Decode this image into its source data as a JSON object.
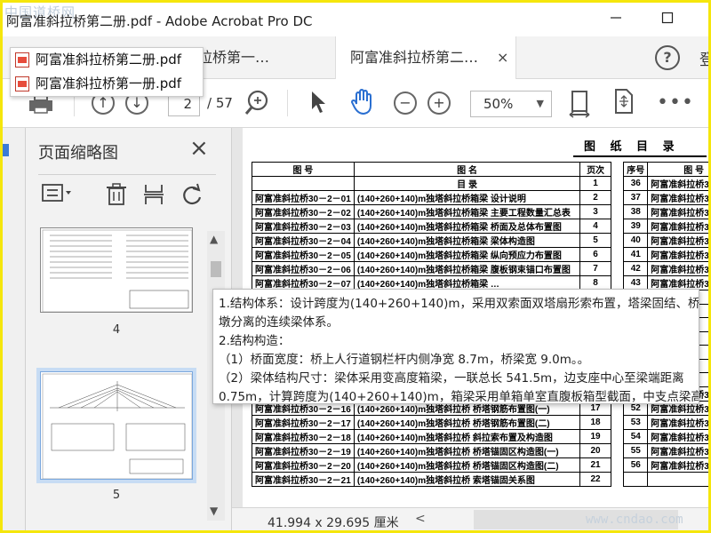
{
  "window": {
    "title": "阿富准斜拉桥第二册.pdf - Adobe Acrobat Pro DC",
    "watermark_logo": "中国道桥网",
    "minimize_icon": "minimize-icon",
    "maximize_icon": "maximize-icon"
  },
  "tabs": [
    {
      "label": "拉桥第一…",
      "active": false
    },
    {
      "label": "阿富准斜拉桥第二…",
      "active": true,
      "close": "×"
    }
  ],
  "help_label": "?",
  "signin_label": "登",
  "recent_files": [
    {
      "name": "阿富准斜拉桥第二册.pdf"
    },
    {
      "name": "阿富准斜拉桥第一册.pdf"
    }
  ],
  "toolbar": {
    "page_current": "2",
    "page_total": "/ 57",
    "zoom": "50%",
    "zoom_arrow": "▼"
  },
  "thumb_panel": {
    "title": "页面缩略图",
    "close": "×",
    "thumbnails": [
      {
        "number": "4",
        "selected": false
      },
      {
        "number": "5",
        "selected": true
      }
    ]
  },
  "document": {
    "heading": "图 纸 目 录",
    "columns": [
      "图    号",
      "图          名",
      "页次",
      "序号",
      "图    号"
    ],
    "rows": [
      {
        "code": "",
        "name": "目    录",
        "page": "1",
        "no": "36",
        "code2": "阿富准斜拉桥30－2－"
      },
      {
        "code": "阿富准斜拉桥30－2－01",
        "name": "(140+260+140)m独塔斜拉桥箱梁  设计说明",
        "page": "2",
        "no": "37",
        "code2": "阿富准斜拉桥30－2－"
      },
      {
        "code": "阿富准斜拉桥30－2－02",
        "name": "(140+260+140)m独塔斜拉桥箱梁  主要工程数量汇总表",
        "page": "3",
        "no": "38",
        "code2": "阿富准斜拉桥30－2－"
      },
      {
        "code": "阿富准斜拉桥30－2－03",
        "name": "(140+260+140)m独塔斜拉桥箱梁  桥面及总体布置图",
        "page": "4",
        "no": "39",
        "code2": "阿富准斜拉桥30－2－"
      },
      {
        "code": "阿富准斜拉桥30－2－04",
        "name": "(140+260+140)m独塔斜拉桥箱梁  梁体构造图",
        "page": "5",
        "no": "40",
        "code2": "阿富准斜拉桥30－2－"
      },
      {
        "code": "阿富准斜拉桥30－2－05",
        "name": "(140+260+140)m独塔斜拉桥箱梁  纵向预应力布置图",
        "page": "6",
        "no": "41",
        "code2": "阿富准斜拉桥30－2－"
      },
      {
        "code": "阿富准斜拉桥30－2－06",
        "name": "(140+260+140)m独塔斜拉桥箱梁  腹板钢束锚口布置图",
        "page": "7",
        "no": "42",
        "code2": "阿富准斜拉桥30－2－"
      },
      {
        "code": "阿富准斜拉桥30－2－07",
        "name": "(140+260+140)m独塔斜拉桥箱梁  …",
        "page": "8",
        "no": "43",
        "code2": "阿富准斜拉桥30－2－"
      },
      {
        "code": "",
        "name": "",
        "page": "",
        "no": "",
        "code2": ""
      },
      {
        "code": "",
        "name": "",
        "page": "",
        "no": "",
        "code2": ""
      },
      {
        "code": "",
        "name": "",
        "page": "",
        "no": "",
        "code2": ""
      },
      {
        "code": "",
        "name": "",
        "page": "",
        "no": "",
        "code2": ""
      },
      {
        "code": "",
        "name": "",
        "page": "",
        "no": "",
        "code2": ""
      },
      {
        "code": "",
        "name": "",
        "page": "",
        "no": "",
        "code2": ""
      },
      {
        "code": "",
        "name": "",
        "page": "",
        "no": "",
        "code2": ""
      },
      {
        "code": "阿富准斜拉桥30－2－15",
        "name": "(140+260+140)m独塔斜拉桥  桥塔构造图",
        "page": "16",
        "no": "51",
        "code2": "阿富准斜拉桥30－2－"
      },
      {
        "code": "阿富准斜拉桥30－2－16",
        "name": "(140+260+140)m独塔斜拉桥  桥塔钢筋布置图(一)",
        "page": "17",
        "no": "52",
        "code2": "阿富准斜拉桥30－2－"
      },
      {
        "code": "阿富准斜拉桥30－2－17",
        "name": "(140+260+140)m独塔斜拉桥  桥塔钢筋布置图(二)",
        "page": "18",
        "no": "53",
        "code2": "阿富准斜拉桥30－2－"
      },
      {
        "code": "阿富准斜拉桥30－2－18",
        "name": "(140+260+140)m独塔斜拉桥  斜拉索布置及构造图",
        "page": "19",
        "no": "54",
        "code2": "阿富准斜拉桥30－2－"
      },
      {
        "code": "阿富准斜拉桥30－2－19",
        "name": "(140+260+140)m独塔斜拉桥  桥塔锚固区构造图(一)",
        "page": "20",
        "no": "55",
        "code2": "阿富准斜拉桥30－2－"
      },
      {
        "code": "阿富准斜拉桥30－2－20",
        "name": "(140+260+140)m独塔斜拉桥  桥塔锚固区构造图(二)",
        "page": "21",
        "no": "56",
        "code2": "阿富准斜拉桥30－2－"
      },
      {
        "code": "阿富准斜拉桥30－2－21",
        "name": "(140+260+140)m独塔斜拉桥  索塔锚固关系图",
        "page": "22",
        "no": "",
        "code2": ""
      }
    ]
  },
  "popup": {
    "lines": [
      "1.结构体系：设计跨度为(140+260+140)m，采用双索面双塔扇形索布置，塔梁固结、桥",
      "墩分离的连续梁体系。",
      "2.结构构造：",
      "（1）桥面宽度：桥上人行道钢栏杆内侧净宽 8.7m，桥梁宽 9.0m。。",
      "（2）梁体结构尺寸：梁体采用变高度箱梁，一联总长 541.5m，边支座中心至梁端距离",
      "0.75m，计算跨度为(140+260+140)m，箱梁采用单箱单室直腹板箱型截面，中支点梁高"
    ]
  },
  "status": {
    "dimensions": "41.994 x 29.695 厘米",
    "scroll_left": "<",
    "watermark": "www.cndao.com"
  },
  "colors": {
    "border_frame": "#f5e60c",
    "accent_blue": "#3b7bd6",
    "pdf_red": "#e74c3c"
  }
}
